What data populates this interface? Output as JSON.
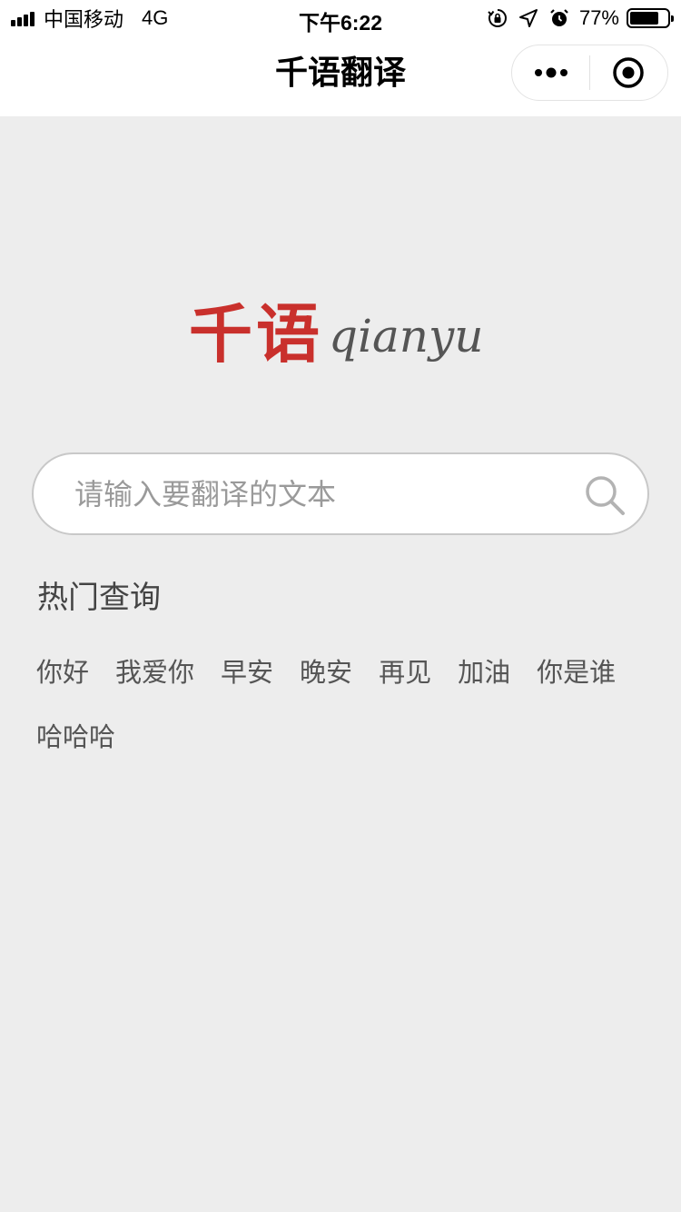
{
  "status_bar": {
    "carrier": "中国移动",
    "network": "4G",
    "time": "下午6:22",
    "battery_percent": "77%",
    "battery_level": 0.77,
    "icons": [
      "rotation-lock-icon",
      "location-arrow-icon",
      "alarm-icon"
    ]
  },
  "nav": {
    "title": "千语翻译",
    "more_icon": "more-dots-icon",
    "close_icon": "target-close-icon"
  },
  "logo": {
    "chinese": "千语",
    "latin": "qianyu",
    "colors": {
      "chinese": "#c9302c",
      "latin": "#555555"
    }
  },
  "search": {
    "placeholder": "请输入要翻译的文本",
    "value": "",
    "icon": "search-icon"
  },
  "hot": {
    "title": "热门查询",
    "items": [
      "你好",
      "我爱你",
      "早安",
      "晚安",
      "再见",
      "加油",
      "你是谁",
      "哈哈哈"
    ]
  },
  "colors": {
    "background": "#ededed",
    "nav_background": "#ffffff",
    "accent": "#c9302c"
  }
}
